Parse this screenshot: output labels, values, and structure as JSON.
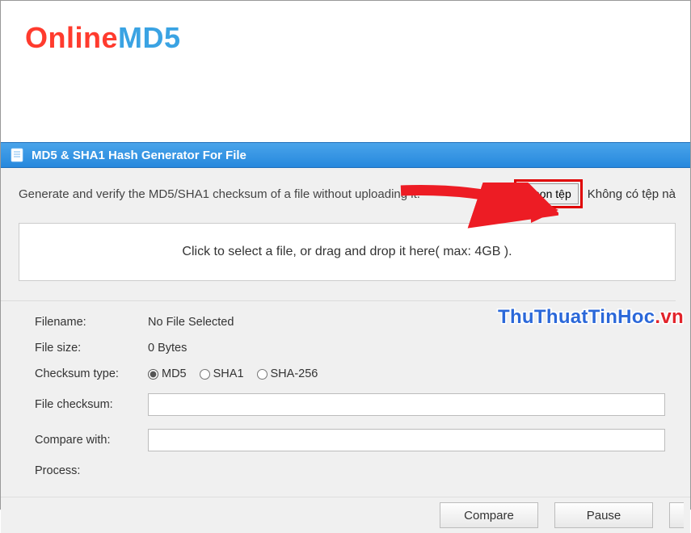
{
  "logo": {
    "part1": "Online",
    "part2": "MD5"
  },
  "panel": {
    "title": "MD5 & SHA1 Hash Generator For File",
    "description": "Generate and verify the MD5/SHA1 checksum of a file without uploading it.",
    "choose_file_label": "Chọn tệp",
    "no_file_label": "Không có tệp nà",
    "dropzone_text": "Click to select a file, or drag and drop it here( max: 4GB )."
  },
  "fields": {
    "filename_label": "Filename:",
    "filename_value": "No File Selected",
    "filesize_label": "File size:",
    "filesize_value": "0 Bytes",
    "checksum_type_label": "Checksum type:",
    "checksum_type_options": {
      "md5": "MD5",
      "sha1": "SHA1",
      "sha256": "SHA-256"
    },
    "file_checksum_label": "File checksum:",
    "file_checksum_value": "",
    "compare_with_label": "Compare with:",
    "compare_with_value": "",
    "process_label": "Process:"
  },
  "buttons": {
    "compare": "Compare",
    "pause": "Pause"
  },
  "watermark": {
    "a": "ThuThuatTinHoc",
    "b": ".vn"
  }
}
